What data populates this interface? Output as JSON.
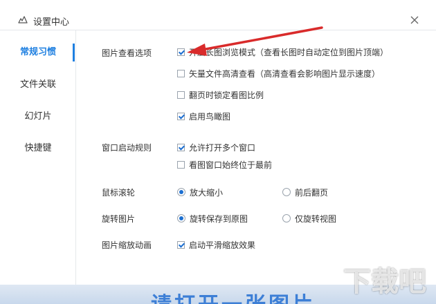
{
  "window": {
    "title": "设置中心"
  },
  "sidebar": {
    "items": [
      {
        "label": "常规习惯",
        "active": true
      },
      {
        "label": "文件关联",
        "active": false
      },
      {
        "label": "幻灯片",
        "active": false
      },
      {
        "label": "快捷键",
        "active": false
      }
    ]
  },
  "sections": {
    "image_view": {
      "label": "图片查看选项",
      "options": [
        {
          "label": "开启长图浏览模式（查看长图时自动定位到图片顶端）",
          "checked": true
        },
        {
          "label": "矢量文件高清查看（高清查看会影响图片显示速度）",
          "checked": false
        },
        {
          "label": "翻页时锁定看图比例",
          "checked": false
        },
        {
          "label": "启用鸟瞰图",
          "checked": true
        }
      ]
    },
    "window_start": {
      "label": "窗口启动规则",
      "options": [
        {
          "label": "允许打开多个窗口",
          "checked": true
        },
        {
          "label": "看图窗口始终位于最前",
          "checked": false
        }
      ]
    },
    "mouse_wheel": {
      "label": "鼠标滚轮",
      "options": [
        {
          "label": "放大缩小",
          "selected": true
        },
        {
          "label": "前后翻页",
          "selected": false
        }
      ]
    },
    "rotate": {
      "label": "旋转图片",
      "options": [
        {
          "label": "旋转保存到原图",
          "selected": true
        },
        {
          "label": "仅旋转视图",
          "selected": false
        }
      ]
    },
    "zoom_anim": {
      "label": "图片缩放动画",
      "options": [
        {
          "label": "启动平滑缩放效果",
          "checked": true
        }
      ]
    }
  },
  "background": {
    "cta_text": "请打开一张图片"
  },
  "watermark": {
    "text": "下载吧"
  },
  "colors": {
    "accent": "#1e7fe0",
    "arrow": "#d92b2b"
  }
}
